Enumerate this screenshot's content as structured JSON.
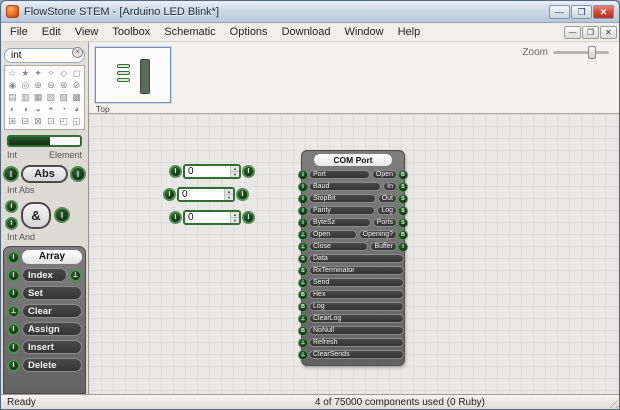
{
  "window": {
    "title": "FlowStone STEM - [Arduino LED Blink*]",
    "controls": {
      "minimize": "—",
      "maximize": "❐",
      "close": "✕"
    }
  },
  "menu": {
    "items": [
      {
        "label": "File"
      },
      {
        "label": "Edit"
      },
      {
        "label": "View"
      },
      {
        "label": "Toolbox"
      },
      {
        "label": "Schematic"
      },
      {
        "label": "Options"
      },
      {
        "label": "Download"
      },
      {
        "label": "Window"
      },
      {
        "label": "Help"
      }
    ],
    "mdi": {
      "minimize": "—",
      "restore": "❐",
      "close": "✕"
    }
  },
  "navigator": {
    "tab": "Top",
    "zoom_label": "Zoom"
  },
  "toolbox": {
    "search": {
      "value": "int",
      "clear_icon": "✕"
    },
    "icons": [
      "☆",
      "★",
      "✦",
      "✧",
      "◇",
      "◻",
      "◉",
      "◎",
      "⊕",
      "⊖",
      "⊗",
      "⊘",
      "▤",
      "▥",
      "▦",
      "▧",
      "▨",
      "▩",
      "◐",
      "◑",
      "◒",
      "◓",
      "◔",
      "◕",
      "⊞",
      "⊟",
      "⊠",
      "⊡",
      "◰",
      "◱"
    ],
    "int_item": {
      "caption": "Int",
      "category": "Element"
    },
    "abs_item": {
      "in": "I",
      "label": "Abs",
      "out": "I",
      "caption": "Int Abs"
    },
    "and_item": {
      "in1": "I",
      "in2": "I",
      "label": "&",
      "out": "I",
      "caption": "Int And"
    },
    "array_item": {
      "in": "I",
      "title": "Array",
      "rows": [
        {
          "in": "I",
          "label": "Index",
          "out": "⊥"
        },
        {
          "in": "I",
          "label": "Set"
        },
        {
          "in": "⊥",
          "label": "Clear"
        },
        {
          "in": "I",
          "label": "Assign"
        },
        {
          "in": "I",
          "label": "Insert"
        },
        {
          "in": "I",
          "label": "Delete"
        }
      ]
    }
  },
  "canvas": {
    "inputs": [
      {
        "in": "I",
        "value": "0",
        "up": "▲",
        "down": "▼",
        "out": "I"
      },
      {
        "in": "I",
        "value": "0",
        "up": "▲",
        "down": "▼",
        "out": "I"
      },
      {
        "in": "I",
        "value": "0",
        "up": "▲",
        "down": "▼",
        "out": "I"
      }
    ],
    "com_port": {
      "title": "COM Port",
      "rows": [
        {
          "in": "I",
          "label": "Port",
          "right": "Open",
          "out": "B"
        },
        {
          "in": "I",
          "label": "Baud",
          "right": "In",
          "out": "S"
        },
        {
          "in": "I",
          "label": "StopBit",
          "right": "Out",
          "out": "S"
        },
        {
          "in": "I",
          "label": "Parity",
          "right": "Log",
          "out": "S"
        },
        {
          "in": "I",
          "label": "ByteSz",
          "right": "Ports",
          "out": "S"
        },
        {
          "in": "⊥",
          "label": "Open",
          "right": "Opening?",
          "out": "B"
        },
        {
          "in": "⊥",
          "label": "Close",
          "right": "Buffer",
          "out": "I"
        },
        {
          "in": "S",
          "label": "Data"
        },
        {
          "in": "S",
          "label": "RxTerminator"
        },
        {
          "in": "⊥",
          "label": "Send"
        },
        {
          "in": "B",
          "label": "Hex"
        },
        {
          "in": "B",
          "label": "Log"
        },
        {
          "in": "⊥",
          "label": "ClearLog"
        },
        {
          "in": "B",
          "label": "NoNull"
        },
        {
          "in": "⊥",
          "label": "Refresh"
        },
        {
          "in": "⊥",
          "label": "ClearSends"
        }
      ]
    }
  },
  "status": {
    "ready": "Ready",
    "info": "4 of 75000 components used (0 Ruby)"
  }
}
